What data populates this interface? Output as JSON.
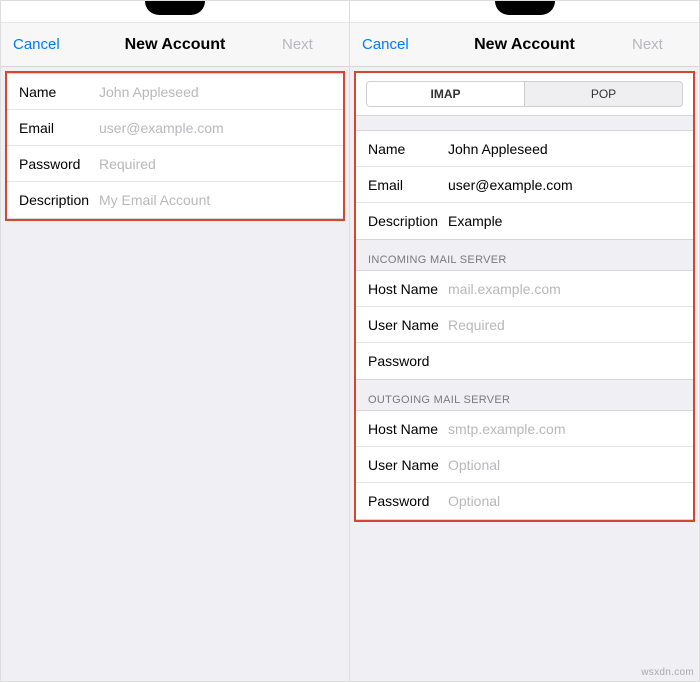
{
  "left": {
    "nav": {
      "cancel": "Cancel",
      "title": "New Account",
      "next": "Next"
    },
    "fields": {
      "name": {
        "label": "Name",
        "value": "",
        "placeholder": "John Appleseed"
      },
      "email": {
        "label": "Email",
        "value": "",
        "placeholder": "user@example.com"
      },
      "password": {
        "label": "Password",
        "value": "",
        "placeholder": "Required"
      },
      "description": {
        "label": "Description",
        "value": "",
        "placeholder": "My Email Account"
      }
    }
  },
  "right": {
    "nav": {
      "cancel": "Cancel",
      "title": "New Account",
      "next": "Next"
    },
    "segmented": {
      "imap": "IMAP",
      "pop": "POP",
      "selected": "IMAP"
    },
    "account": {
      "name": {
        "label": "Name",
        "value": "John Appleseed",
        "placeholder": ""
      },
      "email": {
        "label": "Email",
        "value": "user@example.com",
        "placeholder": ""
      },
      "description": {
        "label": "Description",
        "value": "Example",
        "placeholder": ""
      }
    },
    "incoming": {
      "header": "Incoming Mail Server",
      "host": {
        "label": "Host Name",
        "value": "",
        "placeholder": "mail.example.com"
      },
      "user": {
        "label": "User Name",
        "value": "",
        "placeholder": "Required"
      },
      "pass": {
        "label": "Password",
        "value": "",
        "placeholder": ""
      }
    },
    "outgoing": {
      "header": "Outgoing Mail Server",
      "host": {
        "label": "Host Name",
        "value": "",
        "placeholder": "smtp.example.com"
      },
      "user": {
        "label": "User Name",
        "value": "",
        "placeholder": "Optional"
      },
      "pass": {
        "label": "Password",
        "value": "",
        "placeholder": "Optional"
      }
    }
  },
  "watermark": "wsxdn.com"
}
